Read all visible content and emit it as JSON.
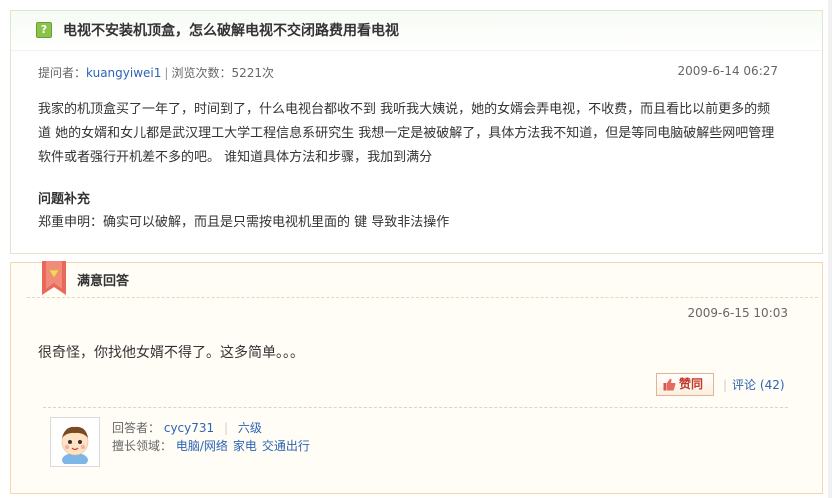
{
  "question": {
    "icon": "question-icon",
    "title": "电视不安装机顶盒，怎么破解电视不交闭路费用看电视",
    "asker_label": "提问者：",
    "asker_name": "kuangyiwei1",
    "separator": "|",
    "views_label": "浏览次数：5221次",
    "date": "2009-6-14 06:27",
    "body": "我家的机顶盒买了一年了，时间到了，什么电视台都收不到 我听我大姨说，她的女婿会弄电视，不收费，而且看比以前更多的频道 她的女婿和女儿都是武汉理工大学工程信息系研究生 我想一定是被破解了，具体方法我不知道，但是等同电脑破解些网吧管理软件或者强行开机差不多的吧。 谁知道具体方法和步骤，我加到满分",
    "supplement_title": "问题补充",
    "supplement_body": "郑重申明：确实可以破解，而且是只需按电视机里面的 键 导致非法操作"
  },
  "answer": {
    "title": "满意回答",
    "date": "2009-6-15 10:03",
    "body": "很奇怪，你找他女婿不得了。这多简单。。。",
    "like_label": "赞同",
    "comment_sep": "|",
    "comment_label": "评论",
    "comment_count": "(42)",
    "answerer_label": "回答者：",
    "answerer_name": "cycy731",
    "answerer_sep": "|",
    "answerer_level": "六级",
    "expertise_label": "擅长领域：",
    "expertise": [
      "电脑/网络",
      "家电",
      "交通出行"
    ]
  },
  "colors": {
    "question_border": "#d9e7d3",
    "answer_border": "#f3d7b4",
    "link": "#2d64b3",
    "ribbon": "#e8685a"
  }
}
